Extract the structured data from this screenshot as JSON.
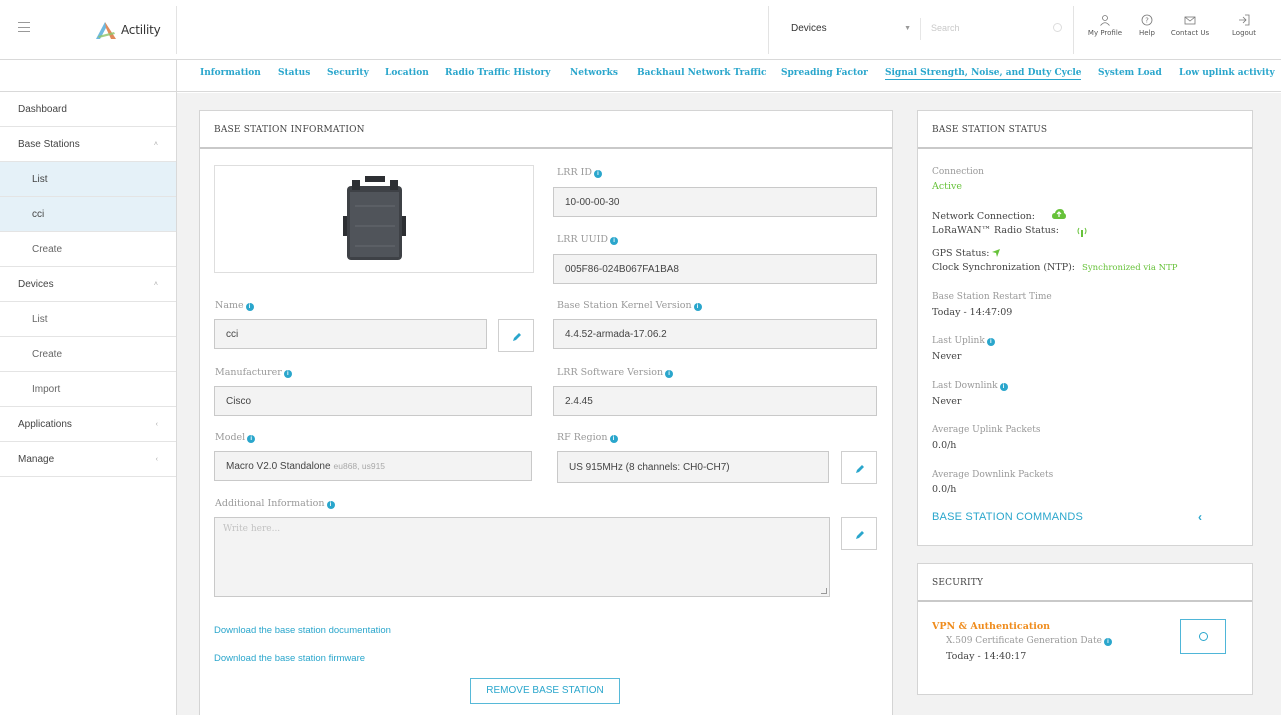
{
  "app": {
    "logo_text": "Actility"
  },
  "header": {
    "dropdown_value": "Devices",
    "search_placeholder": "Search",
    "actions": [
      {
        "label": "My Profile",
        "icon": "user-icon"
      },
      {
        "label": "Help",
        "icon": "help-icon"
      },
      {
        "label": "Contact Us",
        "icon": "mail-icon"
      },
      {
        "label": "Logout",
        "icon": "logout-icon"
      }
    ]
  },
  "sidebar": {
    "items": [
      {
        "label": "Dashboard"
      },
      {
        "label": "Base Stations",
        "chevron": "˄"
      },
      {
        "label": "List"
      },
      {
        "label": "cci"
      },
      {
        "label": "Create"
      },
      {
        "label": "Devices",
        "chevron": "˄"
      },
      {
        "label": "List"
      },
      {
        "label": "Create"
      },
      {
        "label": "Import"
      },
      {
        "label": "Applications",
        "chevron": "‹"
      },
      {
        "label": "Manage",
        "chevron": "‹"
      }
    ]
  },
  "tabs": [
    "Information",
    "Status",
    "Security",
    "Location",
    "Radio Traffic History",
    "Networks",
    "Backhaul Network Traffic",
    "Spreading Factor",
    "Signal Strength, Noise, and Duty Cycle",
    "System Load",
    "Low uplink activity"
  ],
  "info_panel": {
    "title": "BASE STATION INFORMATION",
    "lrr_id_label": "LRR ID",
    "lrr_id": "10-00-00-30",
    "lrr_uuid_label": "LRR UUID",
    "lrr_uuid": "005F86-024B067FA1BA8",
    "name_label": "Name",
    "name": "cci",
    "kernel_label": "Base Station Kernel Version",
    "kernel": "4.4.52-armada-17.06.2",
    "manufacturer_label": "Manufacturer",
    "manufacturer": "Cisco",
    "lrr_sw_label": "LRR Software Version",
    "lrr_sw": "2.4.45",
    "model_label": "Model",
    "model": "Macro V2.0 Standalone",
    "model_bands": "eu868, us915",
    "rf_region_label": "RF Region",
    "rf_region": "US 915MHz (8 channels: CH0-CH7)",
    "additional_label": "Additional Information",
    "additional_placeholder": "Write here...",
    "doc_link": "Download the base station documentation",
    "fw_link": "Download the base station firmware",
    "remove_button": "REMOVE BASE STATION"
  },
  "status_panel": {
    "title": "BASE STATION STATUS",
    "connection_label": "Connection",
    "connection_value": "Active",
    "network_connection_label": "Network Connection:",
    "radio_status_label": "LoRaWAN™ Radio Status:",
    "gps_label": "GPS Status:",
    "clock_label": "Clock Synchronization (NTP):",
    "clock_value": "Synchronized via NTP",
    "restart_label": "Base Station Restart Time",
    "restart_value": "Today - 14:47:09",
    "last_uplink_label": "Last Uplink",
    "last_uplink_value": "Never",
    "last_downlink_label": "Last Downlink",
    "last_downlink_value": "Never",
    "avg_uplink_label": "Average Uplink Packets",
    "avg_uplink_value": "0.0/h",
    "avg_downlink_label": "Average Downlink Packets",
    "avg_downlink_value": "0.0/h",
    "commands_link": "BASE STATION COMMANDS"
  },
  "security_panel": {
    "title": "SECURITY",
    "vpn_label": "VPN & Authentication",
    "cert_label": "X.509 Certificate Generation Date",
    "cert_value": "Today - 14:40:17"
  },
  "colors": {
    "accent": "#2aa6cc",
    "green": "#67c23a",
    "orange": "#ef8c1d"
  }
}
